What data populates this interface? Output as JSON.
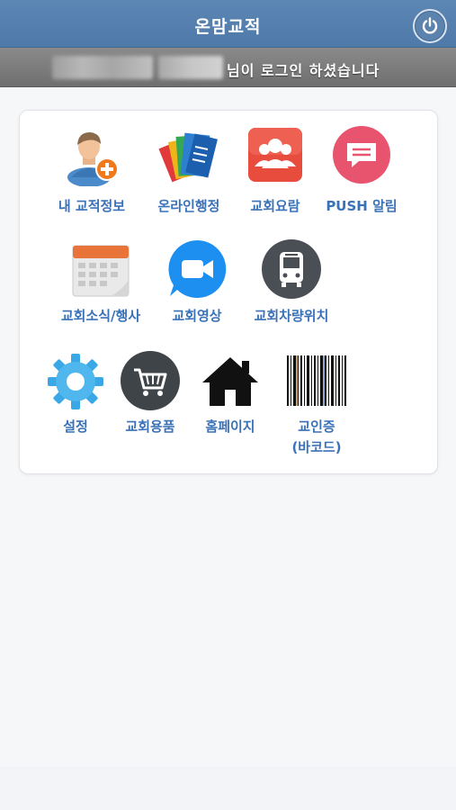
{
  "header": {
    "title": "온맘교적",
    "power_icon": "power-icon"
  },
  "status": {
    "user_name": "",
    "message": "님이 로그인 하셨습니다"
  },
  "menu": {
    "my_info": "내 교적정보",
    "online_admin": "온라인행정",
    "church_directory": "교회요람",
    "push_alarm": "PUSH 알림",
    "church_news": "교회소식/행사",
    "church_video": "교회영상",
    "bus_location": "교회차량위치",
    "settings": "설정",
    "church_goods": "교회용품",
    "homepage": "홈페이지",
    "member_card_line1": "교인증",
    "member_card_line2": "(바코드)"
  },
  "colors": {
    "header": "#5a84b2",
    "status_bar": "#7d7d7d",
    "label_blue": "#3a72b8",
    "directory_red": "#e74c3c",
    "push_pink": "#e8546e",
    "video_blue": "#1d8ff0",
    "bus_dark": "#4a4f55",
    "gear_blue": "#3aa8e6"
  }
}
